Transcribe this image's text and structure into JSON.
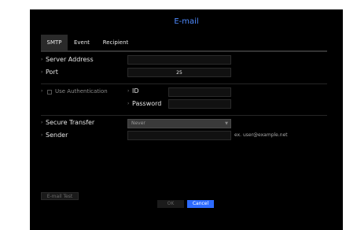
{
  "dialog": {
    "title": "E-mail"
  },
  "tabs": [
    {
      "label": "SMTP",
      "active": true
    },
    {
      "label": "Event",
      "active": false
    },
    {
      "label": "Recipient",
      "active": false
    }
  ],
  "form": {
    "server_address": {
      "label": "Server Address",
      "value": ""
    },
    "port": {
      "label": "Port",
      "value": "25"
    },
    "use_authentication": {
      "label": "Use Authentication",
      "checked": false
    },
    "id": {
      "label": "ID",
      "value": ""
    },
    "password": {
      "label": "Password",
      "value": ""
    },
    "secure_transfer": {
      "label": "Secure Transfer",
      "selected": "Never"
    },
    "sender": {
      "label": "Sender",
      "value": "",
      "hint": "ex. user@example.net"
    }
  },
  "buttons": {
    "email_test": "E-mail Test",
    "ok": "OK",
    "cancel": "Cancel"
  },
  "colors": {
    "accent": "#2d6bff",
    "title": "#4f8bff"
  }
}
